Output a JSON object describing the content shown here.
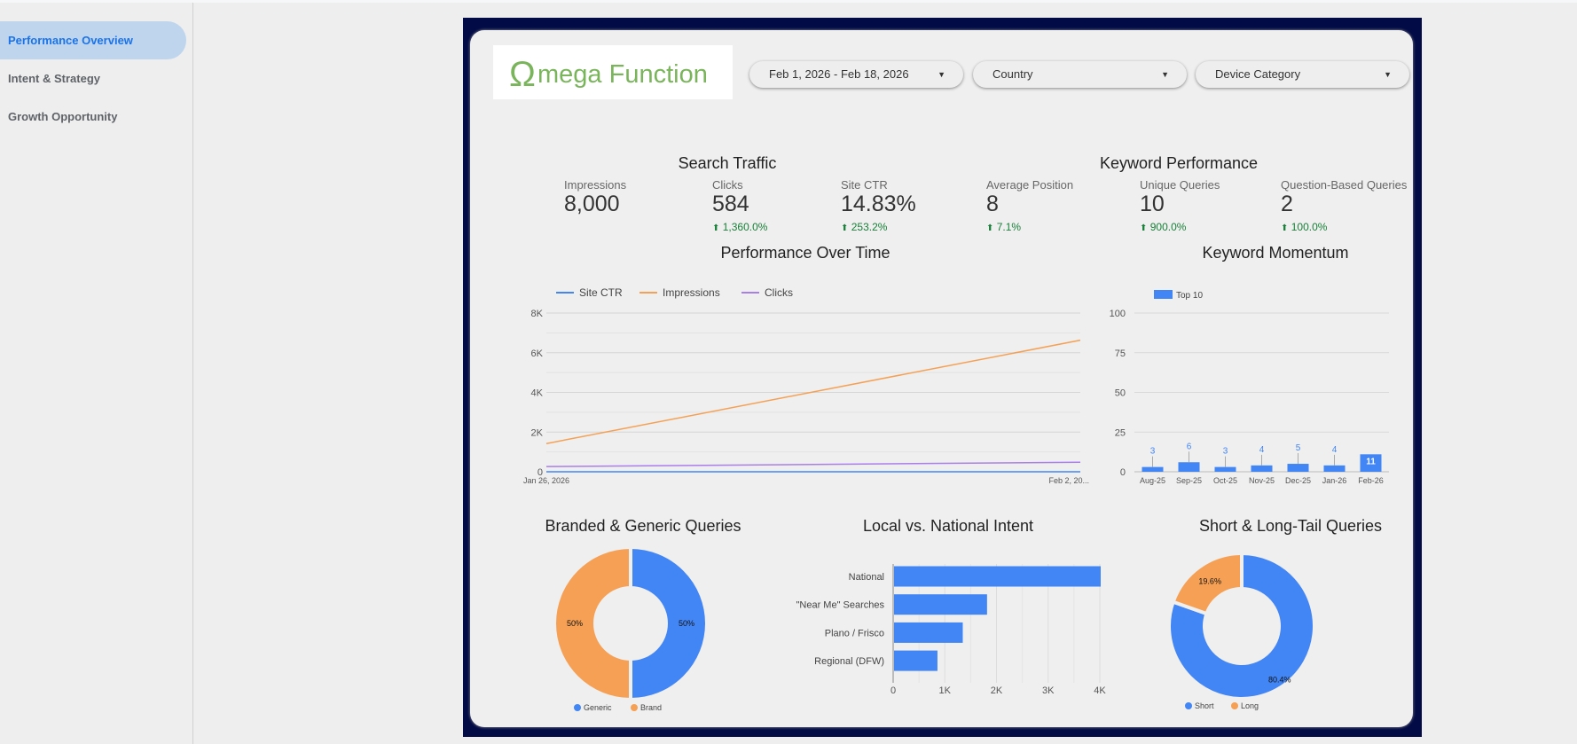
{
  "sidebar": {
    "items": [
      {
        "label": "Performance Overview",
        "active": true
      },
      {
        "label": "Intent & Strategy"
      },
      {
        "label": "Growth Opportunity"
      }
    ]
  },
  "logo": {
    "text": "Omega Function",
    "color": "#7ab55c"
  },
  "filters": {
    "date_range": "Feb 1, 2026 - Feb 18, 2026",
    "country": "Country",
    "device": "Device Category"
  },
  "search_traffic": {
    "title": "Search Traffic",
    "kpis": [
      {
        "label": "Impressions",
        "value": "8,000",
        "delta": ""
      },
      {
        "label": "Clicks",
        "value": "584",
        "delta": "1,360.0%"
      },
      {
        "label": "Site CTR",
        "value": "14.83%",
        "delta": "253.2%"
      },
      {
        "label": "Average Position",
        "value": "8",
        "delta": "7.1%"
      }
    ]
  },
  "keyword_performance": {
    "title": "Keyword Performance",
    "kpis": [
      {
        "label": "Unique Queries",
        "value": "10",
        "delta": "900.0%"
      },
      {
        "label": "Question-Based Queries",
        "value": "2",
        "delta": "100.0%"
      }
    ]
  },
  "colors": {
    "blue": "#4285f4",
    "orange": "#f5a054",
    "purple": "#a97ee8",
    "navy": "#020b45",
    "up": "#188038"
  },
  "chart_data": [
    {
      "type": "line",
      "title": "Performance Over Time",
      "x": [
        "Jan 26, 2026",
        "Feb 2, 20..."
      ],
      "series": [
        {
          "name": "Site CTR",
          "values": [
            0.1,
            0.15
          ],
          "color": "#4285f4"
        },
        {
          "name": "Impressions",
          "values": [
            1420,
            6630
          ],
          "color": "#f5a054"
        },
        {
          "name": "Clicks",
          "values": [
            260,
            480
          ],
          "color": "#a97ee8"
        }
      ],
      "yticks": [
        "0",
        "2K",
        "4K",
        "6K",
        "8K"
      ],
      "ylim": [
        0,
        8000
      ],
      "grid": true,
      "legend": "top-left"
    },
    {
      "type": "bar",
      "title": "Keyword Momentum",
      "categories": [
        "Aug-25",
        "Sep-25",
        "Oct-25",
        "Nov-25",
        "Dec-25",
        "Jan-26",
        "Feb-26"
      ],
      "series": [
        {
          "name": "Top 10",
          "values": [
            3,
            6,
            3,
            4,
            5,
            4,
            11
          ]
        }
      ],
      "yticks": [
        "0",
        "25",
        "50",
        "75",
        "100"
      ],
      "ylim": [
        0,
        100
      ],
      "grid": true,
      "legend": "top-left"
    },
    {
      "type": "pie",
      "title": "Branded & Generic Queries",
      "slices": [
        {
          "label": "Generic",
          "value": 50,
          "text": "50%",
          "color": "#4285f4"
        },
        {
          "label": "Brand",
          "value": 50,
          "text": "50%",
          "color": "#f5a054"
        }
      ],
      "legend": "bottom"
    },
    {
      "type": "bar",
      "orientation": "horizontal",
      "title": "Local vs. National Intent",
      "categories": [
        "National",
        "\"Near Me\" Searches",
        "Plano / Frisco",
        "Regional (DFW)"
      ],
      "values": [
        4000,
        1800,
        1330,
        840
      ],
      "xticks": [
        "0",
        "1K",
        "2K",
        "3K",
        "4K"
      ],
      "xlim": [
        0,
        4000
      ],
      "grid": true
    },
    {
      "type": "pie",
      "title": "Short & Long-Tail Queries",
      "slices": [
        {
          "label": "Short",
          "value": 80.4,
          "text": "80.4%",
          "color": "#4285f4"
        },
        {
          "label": "Long",
          "value": 19.6,
          "text": "19.6%",
          "color": "#f5a054"
        }
      ],
      "legend": "bottom"
    }
  ]
}
